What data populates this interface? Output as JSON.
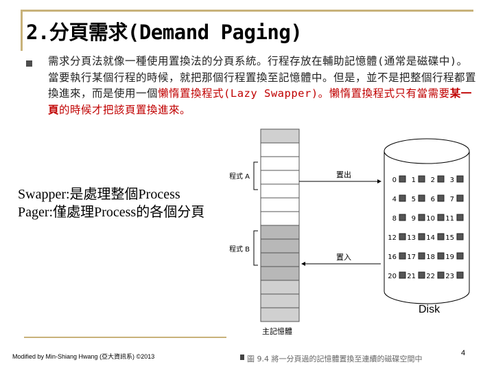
{
  "slide": {
    "title": "2.分頁需求(Demand Paging)",
    "paragraph": {
      "part1": "需求分頁法就像一種使用置換法的分頁系統。行程存放在輔助記憶體(通常是磁碟中)。當要執行某個行程的時候，就把那個行程置換至記憶體中。但是，並不是把整個行程都置換進來，而是使用一個",
      "red1": "懶惰置換程式",
      "part2": "(Lazy Swapper)。懶惰置換程式只有當需要",
      "red2": "某一頁",
      "part3": "的時候才把該頁置換進來。"
    },
    "overlay": {
      "line1": "Swapper:是處理整個Process",
      "line2": "Pager:僅處理Process的各個分頁"
    },
    "footer": "Modified by Min-Shiang Hwang (亞大資訊系) ©2013",
    "page_number": "4"
  },
  "figure": {
    "program_a_label": "程式 A",
    "program_b_label": "程式 B",
    "swap_out_label": "置出",
    "swap_in_label": "置入",
    "memory_label": "主記憶體",
    "disk_label": "Disk",
    "caption": "圖 9.4  將一分頁過的記憶體置換至連續的磁碟空間中",
    "disk_pages": [
      "0",
      "1",
      "2",
      "3",
      "4",
      "5",
      "6",
      "7",
      "8",
      "9",
      "10",
      "11",
      "12",
      "13",
      "14",
      "15",
      "16",
      "17",
      "18",
      "19",
      "20",
      "21",
      "22",
      "23"
    ]
  },
  "colors": {
    "accent_line": "#c8b27a",
    "highlight_red": "#c00000",
    "memory_shade": "#b8b8b8"
  }
}
